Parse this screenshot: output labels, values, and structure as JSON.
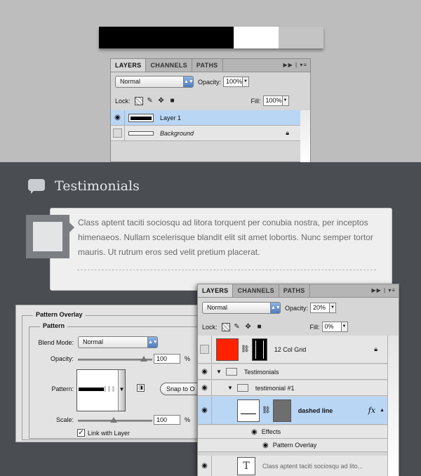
{
  "swatch": {
    "colors": [
      "#000000",
      "#ffffff",
      "#c4c4c4"
    ],
    "widths_fraction": [
      0.6,
      0.2,
      0.2
    ]
  },
  "top_layers_panel": {
    "tabs": [
      "LAYERS",
      "CHANNELS",
      "PATHS"
    ],
    "tab_controls": "▶▶ | ▾≡",
    "blend_mode": "Normal",
    "opacity_label": "Opacity:",
    "opacity_value": "100%",
    "lock_label": "Lock:",
    "fill_label": "Fill:",
    "fill_value": "100%",
    "layers": [
      {
        "name": "Layer 1",
        "visible": true,
        "selected": true
      },
      {
        "name": "Background",
        "visible": false,
        "selected": false,
        "locked": true
      }
    ]
  },
  "testimonials": {
    "heading": "Testimonials",
    "quote": "Class aptent taciti sociosqu ad litora torquent per conubia nostra, per inceptos himenaeos. Nullam scelerisque blandit elit sit amet lobortis. Nunc semper tortor mauris. Ut rutrum eros sed velit pretium placerat."
  },
  "pattern_overlay": {
    "title": "Pattern Overlay",
    "section": "Pattern",
    "blend_mode_label": "Blend Mode:",
    "blend_mode_value": "Normal",
    "opacity_label": "Opacity:",
    "opacity_value": "100",
    "opacity_unit": "%",
    "pattern_label": "Pattern:",
    "snap_button": "Snap to O",
    "scale_label": "Scale:",
    "scale_value": "100",
    "scale_unit": "%",
    "link_label": "Link with Layer",
    "link_checked": true
  },
  "bottom_layers_panel": {
    "tabs": [
      "LAYERS",
      "CHANNELS",
      "PATHS"
    ],
    "blend_mode": "Normal",
    "opacity_label": "Opacity:",
    "opacity_value": "20%",
    "lock_label": "Lock:",
    "fill_label": "Fill:",
    "fill_value": "0%",
    "layers": {
      "grid": "12 Col Grid",
      "group": "Testimonials",
      "subgroup": "testimonial #1",
      "dashed": "dashed line",
      "fx": "fx",
      "effects": "Effects",
      "effect_item": "Pattern Overlay",
      "text_layer": "Class aptent taciti sociosqu ad lito..."
    }
  },
  "colors": {
    "dark_bg": "#4a4e53",
    "selected_row": "#b9d6f5",
    "grid_red": "#ff2200"
  }
}
